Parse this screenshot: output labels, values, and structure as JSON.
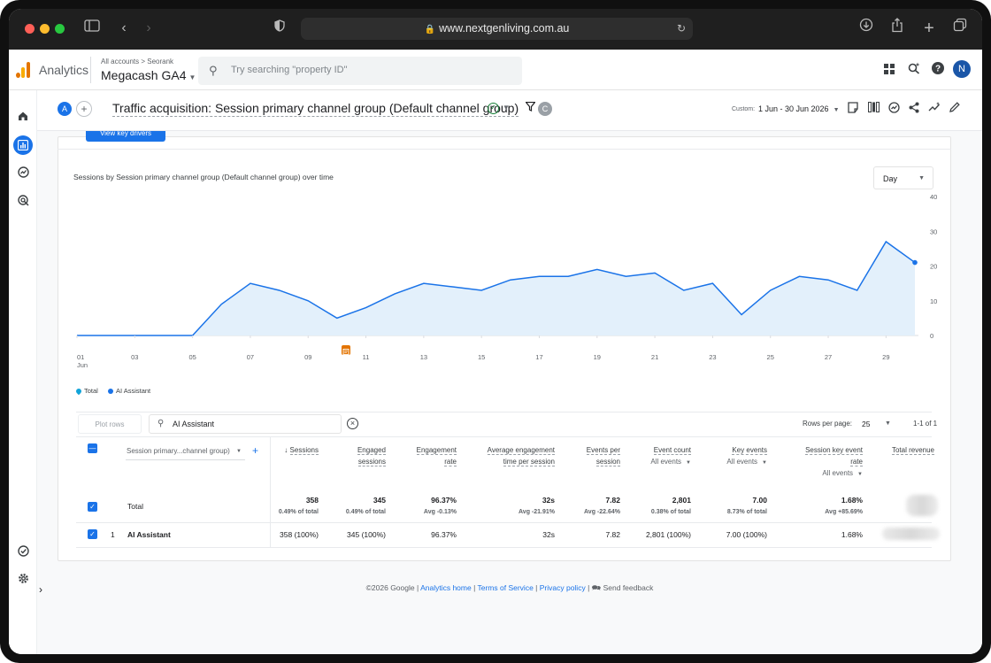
{
  "browser": {
    "url": "www.nextgenliving.com.au",
    "traffic_colors": [
      "#ff5f57",
      "#febc2e",
      "#28c840"
    ]
  },
  "header": {
    "app_name": "Analytics",
    "account_crumb": "All accounts > Seorank",
    "property_name": "Megacash GA4",
    "search_placeholder": "Try searching \"property ID\"",
    "avatar_letter": "N"
  },
  "report": {
    "compare_chip": "A",
    "title": "Traffic acquisition: Session primary channel group (Default channel group)",
    "filter_chip": "C",
    "date_label": "Custom",
    "date_range": "1 Jun - 30 Jun 2026",
    "key_drivers_button": "View key drivers"
  },
  "chart": {
    "title": "Sessions by Session primary channel group (Default channel group) over time",
    "granularity": "Day",
    "legend": [
      {
        "label": "Total",
        "icon": "total-drop-icon"
      },
      {
        "label": "AI Assistant",
        "icon": "series-dot-icon"
      }
    ],
    "annotation_icon": "note-icon"
  },
  "chart_data": {
    "type": "area",
    "x": [
      "01",
      "02",
      "03",
      "04",
      "05",
      "06",
      "07",
      "08",
      "09",
      "10",
      "11",
      "12",
      "13",
      "14",
      "15",
      "16",
      "17",
      "18",
      "19",
      "20",
      "21",
      "22",
      "23",
      "24",
      "25",
      "26",
      "27",
      "28",
      "29",
      "30"
    ],
    "x_tick_labels": [
      "01\nJun",
      "03",
      "05",
      "07",
      "09",
      "11",
      "13",
      "15",
      "17",
      "19",
      "21",
      "23",
      "25",
      "27",
      "29"
    ],
    "series": [
      {
        "name": "AI Assistant",
        "values": [
          0,
          0,
          0,
          0,
          0,
          9,
          15,
          13,
          10,
          5,
          8,
          12,
          15,
          14,
          13,
          16,
          17,
          17,
          19,
          17,
          18,
          13,
          15,
          6,
          13,
          17,
          16,
          13,
          27,
          21
        ],
        "color": "#1a73e8"
      }
    ],
    "y_ticks": [
      0,
      10,
      20,
      30,
      40
    ],
    "ylim": [
      0,
      40
    ],
    "grid": false,
    "fill_color": "#e3f0fb"
  },
  "table": {
    "plot_rows_label": "Plot rows",
    "search_value": "AI Assistant",
    "rows_per_page_label": "Rows per page:",
    "rows_per_page": "25",
    "pagination": "1-1 of 1",
    "dimension_label": "Session primary...channel group)",
    "columns": [
      {
        "label": "Sessions",
        "lines": [
          "Sessions"
        ],
        "sorted": true
      },
      {
        "label": "Engaged sessions",
        "lines": [
          "Engaged",
          "sessions"
        ]
      },
      {
        "label": "Engagement rate",
        "lines": [
          "Engagement",
          "rate"
        ]
      },
      {
        "label": "Average engagement time per session",
        "lines": [
          "Average engagement",
          "time per session"
        ]
      },
      {
        "label": "Events per session",
        "lines": [
          "Events per",
          "session"
        ]
      },
      {
        "label": "Event count",
        "lines": [
          "Event count"
        ],
        "sub": "All events"
      },
      {
        "label": "Key events",
        "lines": [
          "Key events"
        ],
        "sub": "All events"
      },
      {
        "label": "Session key event rate",
        "lines": [
          "Session key event",
          "rate"
        ],
        "sub": "All events"
      },
      {
        "label": "Total revenue",
        "lines": [
          "Total revenue"
        ]
      }
    ],
    "total_row": {
      "label": "Total",
      "values": [
        "358",
        "345",
        "96.37%",
        "32s",
        "7.82",
        "2,801",
        "7.00",
        "1.68%"
      ],
      "subs": [
        "0.49% of total",
        "0.49% of total",
        "Avg -0.13%",
        "Avg -21.91%",
        "Avg -22.64%",
        "0.38% of total",
        "8.73% of total",
        "Avg +85.69%"
      ]
    },
    "rows": [
      {
        "index": "1",
        "label": "AI Assistant",
        "values": [
          "358 (100%)",
          "345 (100%)",
          "96.37%",
          "32s",
          "7.82",
          "2,801 (100%)",
          "7.00 (100%)",
          "1.68%"
        ]
      }
    ]
  },
  "footer": {
    "copyright": "©2026 Google |",
    "links": [
      "Analytics home",
      "Terms of Service",
      "Privacy policy"
    ],
    "feedback": "Send feedback"
  }
}
